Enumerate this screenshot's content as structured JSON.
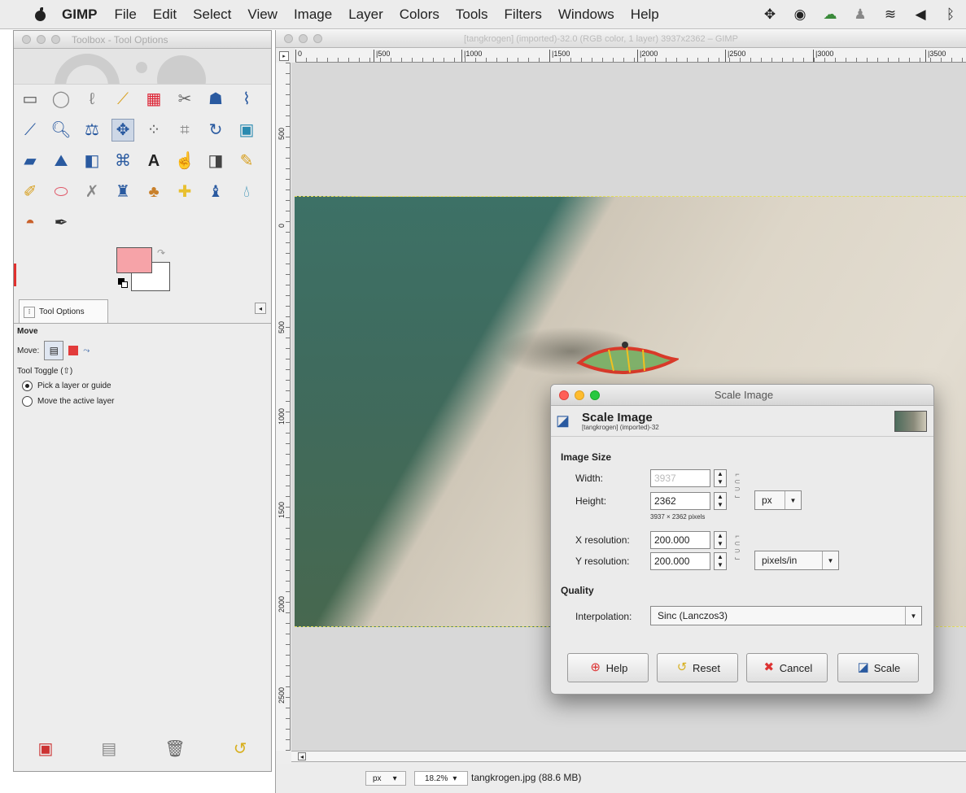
{
  "menubar": {
    "app_name": "GIMP",
    "items": [
      "File",
      "Edit",
      "Select",
      "View",
      "Image",
      "Layer",
      "Colors",
      "Tools",
      "Filters",
      "Windows",
      "Help"
    ]
  },
  "toolbox": {
    "title": "Toolbox - Tool Options",
    "tab_label": "Tool Options",
    "tool_name": "Move",
    "move_label": "Move:",
    "toggle_label": "Tool Toggle  (⇧)",
    "options": [
      "Pick a layer or guide",
      "Move the active layer"
    ],
    "selected_option": 0,
    "fg_color": "#f6a3a8",
    "bg_color": "#ffffff"
  },
  "image_window": {
    "title": "[tangkrogen] (imported)-32.0 (RGB color, 1 layer) 3937x2362 – GIMP",
    "ruler_h": [
      "0",
      "|500",
      "|1000",
      "|1500",
      "|2000",
      "|2500",
      "|3000",
      "|3500"
    ],
    "ruler_v": [
      "500",
      "0",
      "500",
      "1000",
      "1500",
      "2000",
      "2500"
    ],
    "status": {
      "unit": "px",
      "zoom": "18.2%",
      "file": "tangkrogen.jpg (88.6 MB)"
    }
  },
  "dialog": {
    "title": "Scale Image",
    "header_title": "Scale Image",
    "header_subtitle": "[tangkrogen] (imported)-32",
    "image_size_label": "Image Size",
    "width_label": "Width:",
    "width_value": "3937",
    "height_label": "Height:",
    "height_value": "2362",
    "size_unit": "px",
    "pixel_hint": "3937 × 2362 pixels",
    "xres_label": "X resolution:",
    "xres_value": "200.000",
    "yres_label": "Y resolution:",
    "yres_value": "200.000",
    "res_unit": "pixels/in",
    "quality_label": "Quality",
    "interp_label": "Interpolation:",
    "interp_value": "Sinc (Lanczos3)",
    "buttons": {
      "help": "Help",
      "reset": "Reset",
      "cancel": "Cancel",
      "scale": "Scale"
    }
  },
  "icons": {
    "apple": "apple-logo-icon",
    "tray": [
      "dropbox-icon",
      "eye-icon",
      "cloud-icon",
      "bell-icon",
      "wifi-icon",
      "speaker-icon",
      "bluetooth-icon"
    ]
  }
}
